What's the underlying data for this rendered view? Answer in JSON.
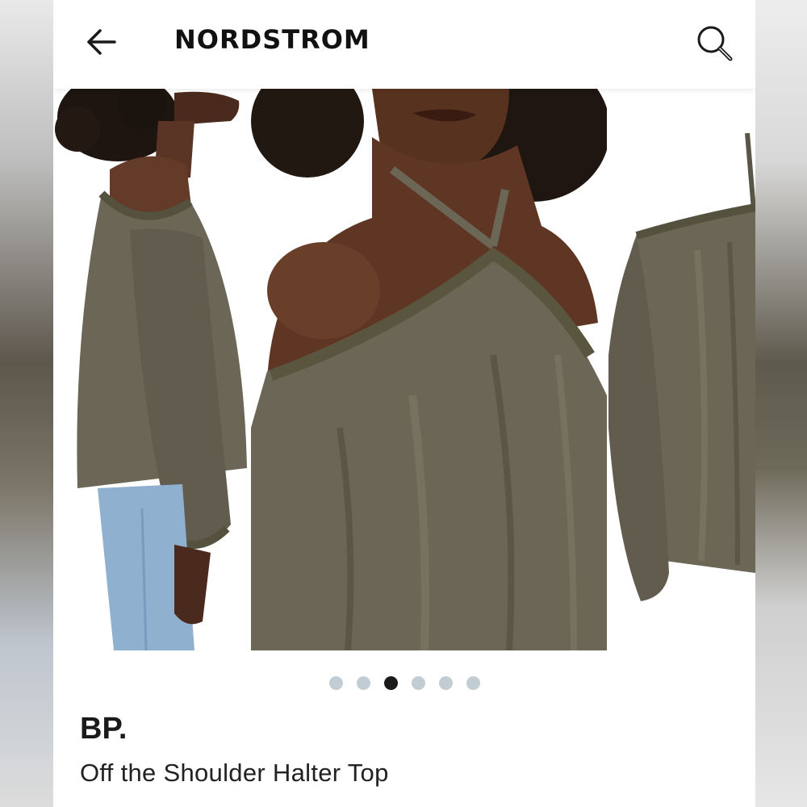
{
  "header": {
    "brand": "NORDSTROM",
    "back_icon": "arrow-left-icon",
    "search_icon": "search-icon"
  },
  "gallery": {
    "images": [
      {
        "subject": "side view of model wearing olive top"
      },
      {
        "subject": "close-up of halter neckline"
      },
      {
        "subject": "olive top flat view"
      }
    ],
    "page_count": 6,
    "current_page": 3
  },
  "product": {
    "brand": "BP.",
    "title": "Off the Shoulder Halter Top"
  },
  "colors": {
    "top_olive": "#6b6656",
    "skin": "#5a3424",
    "dot_inactive": "#c1cdd3",
    "dot_active": "#1a1a1a"
  }
}
